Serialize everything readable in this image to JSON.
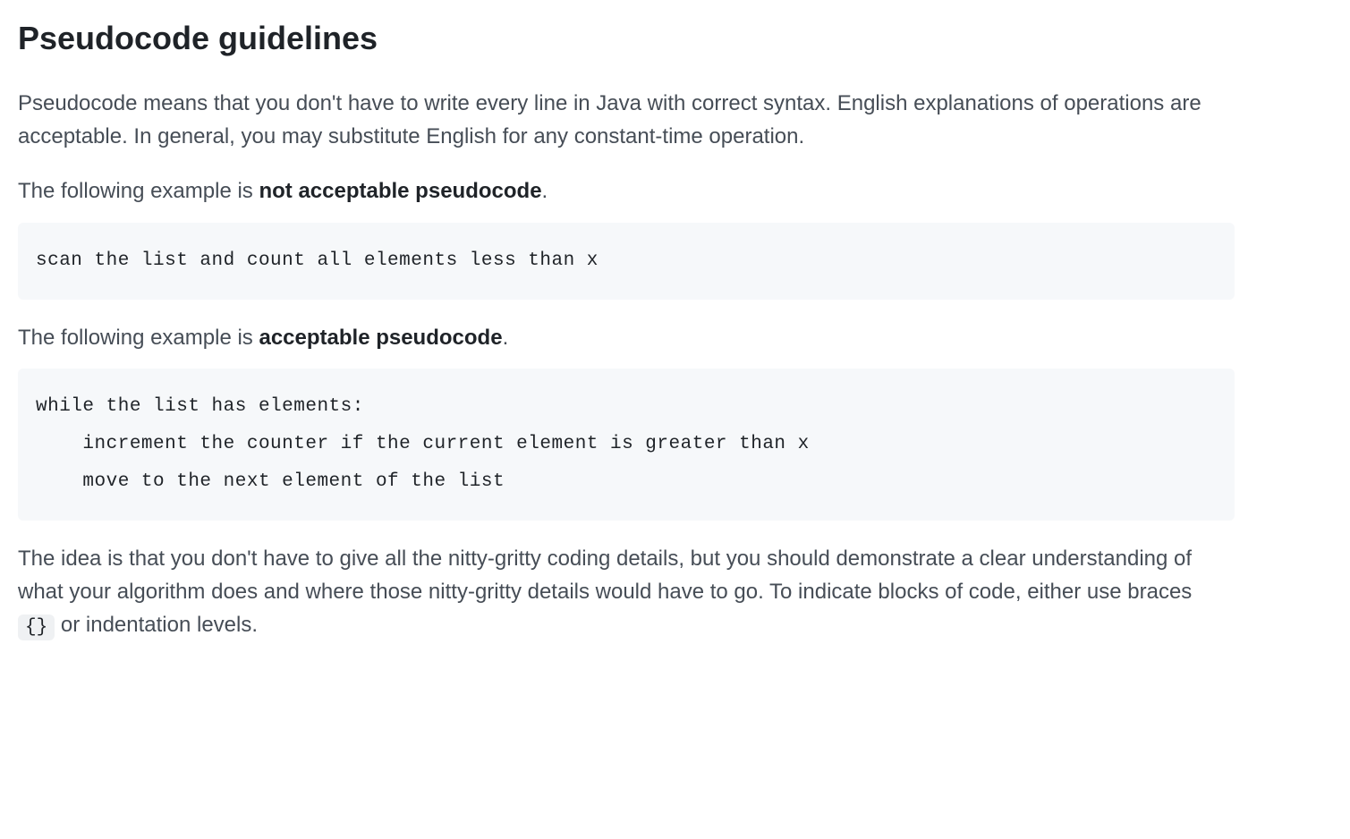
{
  "heading": "Pseudocode guidelines",
  "intro": "Pseudocode means that you don't have to write every line in Java with correct syntax. English explanations of operations are acceptable. In general, you may substitute English for any constant-time operation.",
  "notAcceptable": {
    "prefix": "The following example is ",
    "bold": "not acceptable pseudocode",
    "suffix": "."
  },
  "codeBad": "scan the list and count all elements less than x",
  "acceptable": {
    "prefix": "The following example is ",
    "bold": "acceptable pseudocode",
    "suffix": "."
  },
  "codeGood": "while the list has elements:\n    increment the counter if the current element is greater than x\n    move to the next element of the list",
  "conclusion": {
    "part1": "The idea is that you don't have to give all the nitty-gritty coding details, but you should demonstrate a clear understanding of what your algorithm does and where those nitty-gritty details would have to go. To indicate blocks of code, either use braces ",
    "code": "{}",
    "part2": " or indentation levels."
  }
}
